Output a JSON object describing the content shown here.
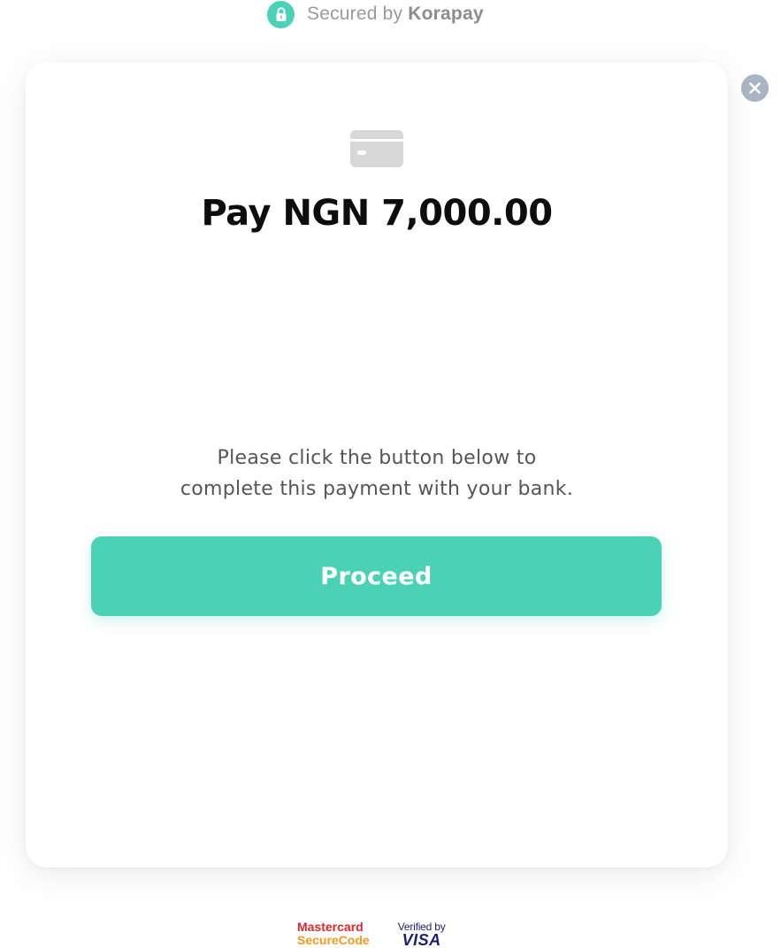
{
  "header": {
    "secured_prefix": "Secured by",
    "brand": "Korapay",
    "lock_icon": "lock-icon"
  },
  "close": {
    "icon": "close-icon"
  },
  "payment": {
    "card_icon": "credit-card-icon",
    "amount_label": "Pay NGN 7,000.00",
    "instruction_line1": "Please click the button below to",
    "instruction_line2": "complete this payment with your bank.",
    "proceed_label": "Proceed"
  },
  "footer": {
    "mastercard_line1": "Mastercard",
    "mastercard_line2": "SecureCode",
    "visa_line1": "Verified by",
    "visa_line2": "VISA"
  },
  "colors": {
    "accent": "#4bd2b6",
    "close_bg": "#a9b5c2",
    "card_icon": "#d8d8d8",
    "mastercard_red": "#e0262a",
    "mastercard_orange": "#f29a1e",
    "visa_blue": "#1a1f71"
  }
}
